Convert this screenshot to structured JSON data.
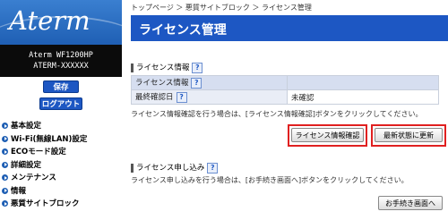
{
  "sidebar": {
    "logo_text": "Aterm",
    "model_line1": "Aterm WF1200HP",
    "model_line2": "ATERM-XXXXXX",
    "save_label": "保存",
    "logout_label": "ログアウト",
    "nav_items": [
      {
        "label": "基本設定"
      },
      {
        "label": "Wi-Fi(無線LAN)設定"
      },
      {
        "label": "ECOモード設定"
      },
      {
        "label": "詳細設定"
      },
      {
        "label": "メンテナンス"
      },
      {
        "label": "情報"
      },
      {
        "label": "悪質サイトブロック"
      }
    ]
  },
  "main": {
    "breadcrumb": "トップページ ＞ 悪質サイトブロック ＞ ライセンス管理",
    "page_title": "ライセンス管理",
    "section1": {
      "title": "ライセンス情報",
      "table_header": "ライセンス情報",
      "row_label": "最終確認日",
      "row_value": "未確認",
      "description": "ライセンス情報確認を行う場合は、[ライセンス情報確認]ボタンをクリックしてください。",
      "license_check_label": "ライセンス情報確認",
      "refresh_label": "最新状態に更新"
    },
    "section2": {
      "title": "ライセンス申し込み",
      "description": "ライセンス申し込みを行う場合は、[お手続き画面へ]ボタンをクリックしてください。",
      "procedure_label": "お手続き画面へ"
    },
    "help_glyph": "?"
  },
  "colors": {
    "brand_blue": "#1d57c3",
    "highlight_red": "#e02020"
  }
}
